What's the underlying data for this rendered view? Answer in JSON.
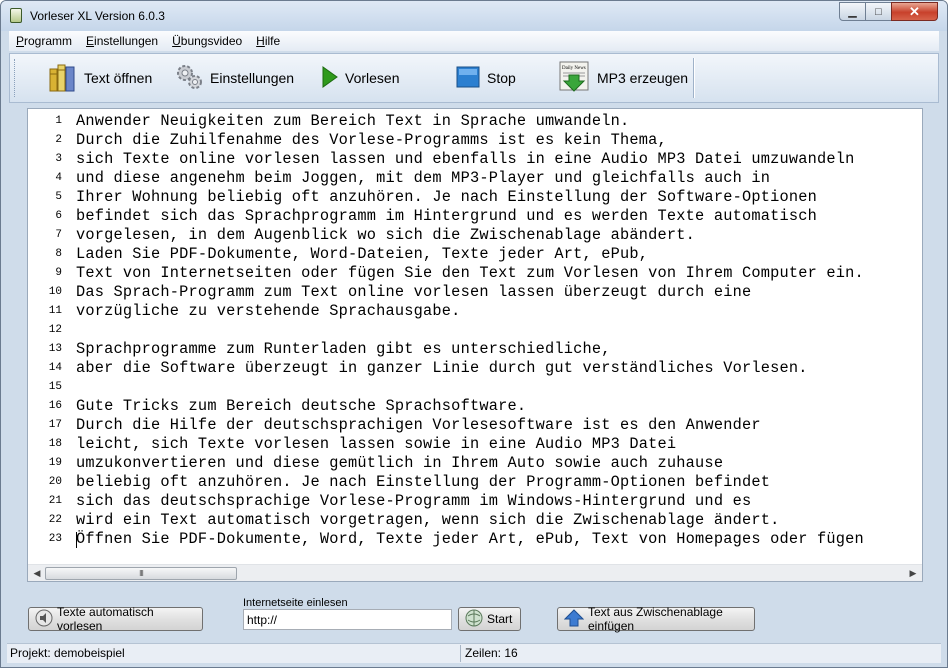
{
  "window": {
    "title": "Vorleser XL Version 6.0.3"
  },
  "menu": {
    "items": [
      {
        "key": "P",
        "rest": "rogramm"
      },
      {
        "key": "E",
        "rest": "instellungen"
      },
      {
        "key": "Ü",
        "rest": "bungsvideo"
      },
      {
        "key": "H",
        "rest": "ilfe"
      }
    ]
  },
  "toolbar": {
    "open_label": "Text öffnen",
    "settings_label": "Einstellungen",
    "read_label": "Vorlesen",
    "stop_label": "Stop",
    "mp3_label": "MP3 erzeugen",
    "mp3_icon_caption": "Daily News"
  },
  "editor": {
    "line_numbers": [
      "1",
      "2",
      "3",
      "4",
      "5",
      "6",
      "7",
      "8",
      "9",
      "10",
      "11",
      "12",
      "13",
      "14",
      "15",
      "16",
      "17",
      "18",
      "19",
      "20",
      "21",
      "22",
      "23"
    ],
    "lines": [
      "Anwender Neuigkeiten zum Bereich Text in Sprache umwandeln.",
      "Durch die Zuhilfenahme des Vorlese-Programms ist es kein Thema,",
      "sich Texte online vorlesen lassen und ebenfalls in eine Audio MP3 Datei umzuwandeln",
      "und diese angenehm beim Joggen, mit dem MP3-Player und gleichfalls auch in",
      "Ihrer Wohnung beliebig oft anzuhören. Je nach Einstellung der Software-Optionen",
      "befindet sich das Sprachprogramm im Hintergrund und es werden Texte automatisch",
      "vorgelesen, in dem Augenblick wo sich die Zwischenablage abändert.",
      "Laden Sie PDF-Dokumente, Word-Dateien, Texte jeder Art, ePub,",
      "Text von Internetseiten oder fügen Sie den Text zum Vorlesen von Ihrem Computer ein.",
      "Das Sprach-Programm zum Text online vorlesen lassen überzeugt durch eine",
      "vorzügliche zu verstehende Sprachausgabe.",
      "",
      "Sprachprogramme zum Runterladen gibt es unterschiedliche,",
      "aber die Software überzeugt in ganzer Linie durch gut verständliches Vorlesen.",
      "",
      "Gute Tricks zum Bereich deutsche Sprachsoftware.",
      "Durch die Hilfe der deutschsprachigen Vorlesesoftware ist es den Anwender",
      "leicht, sich Texte vorlesen lassen sowie in eine Audio MP3 Datei",
      "umzukonvertieren und diese gemütlich in Ihrem Auto sowie auch zuhause",
      "beliebig oft anzuhören. Je nach Einstellung der Programm-Optionen befindet",
      "sich das deutschsprachige Vorlese-Programm im Windows-Hintergrund und es",
      "wird ein Text automatisch vorgetragen, wenn sich die Zwischenablage ändert.",
      "Öffnen Sie PDF-Dokumente, Word, Texte jeder Art, ePub, Text von Homepages oder fügen"
    ],
    "scroll_thumb_glyph": "III"
  },
  "bottom": {
    "auto_read_label": "Texte automatisch vorlesen",
    "url_label": "Internetseite einlesen",
    "url_value": "http://",
    "start_label": "Start",
    "paste_label": "Text aus Zwischenablage einfügen"
  },
  "status": {
    "project": "Projekt: demobeispiel",
    "lines": "Zeilen: 16"
  },
  "colors": {
    "window_frame": "#cfdcea",
    "close_button": "#c8412b",
    "play_icon": "#2f9a1c",
    "stop_icon": "#2b7fd0"
  }
}
